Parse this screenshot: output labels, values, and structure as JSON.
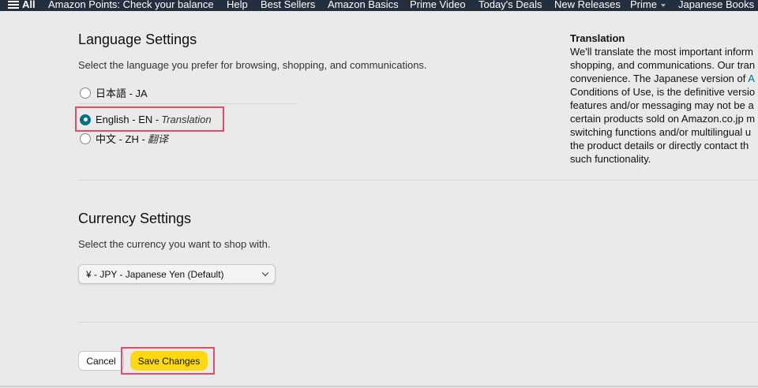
{
  "nav": {
    "all_label": "All",
    "links": [
      "Amazon Points: Check your balance",
      "Help",
      "Best Sellers",
      "Amazon Basics",
      "Prime Video",
      "Today's Deals",
      "New Releases",
      "Prime",
      "Japanese Books"
    ]
  },
  "language": {
    "title": "Language Settings",
    "subtitle": "Select the language you prefer for browsing, shopping, and communications.",
    "options": [
      {
        "label": "日本語 - JA",
        "note": "",
        "selected": false
      },
      {
        "label": "English - EN - ",
        "note": "Translation",
        "selected": true
      },
      {
        "label": "中文 - ZH - ",
        "note": "翻译",
        "selected": false
      }
    ]
  },
  "translation": {
    "title": "Translation",
    "lines": [
      "We'll translate the most important inform",
      "shopping, and communications. Our tran",
      "convenience. The Japanese version of ",
      "Conditions of Use, is the definitive versio",
      "features and/or messaging may not be a",
      "certain products sold on Amazon.co.jp m",
      "switching functions and/or multilingual u",
      "the product details or directly contact th",
      "such functionality."
    ],
    "link_fragment": "A"
  },
  "currency": {
    "title": "Currency Settings",
    "subtitle": "Select the currency you want to shop with.",
    "selected": "¥ - JPY - Japanese Yen (Default)"
  },
  "actions": {
    "cancel": "Cancel",
    "save": "Save Changes"
  }
}
